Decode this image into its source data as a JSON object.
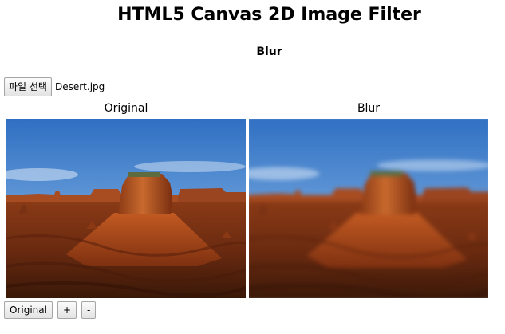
{
  "header": {
    "title": "HTML5 Canvas 2D Image Filter",
    "subtitle": "Blur"
  },
  "file_picker": {
    "button_label": "파일 선택",
    "file_name": "Desert.jpg"
  },
  "panels": {
    "left_caption": "Original",
    "right_caption": "Blur"
  },
  "controls": {
    "original_label": "Original",
    "plus_label": "+",
    "minus_label": "-"
  },
  "colors": {
    "sky_top": "#3b79c8",
    "sky_bottom": "#a9c9ea",
    "rock": "#b4501f",
    "rock_dark": "#6e2a10",
    "ground": "#7a3416"
  }
}
